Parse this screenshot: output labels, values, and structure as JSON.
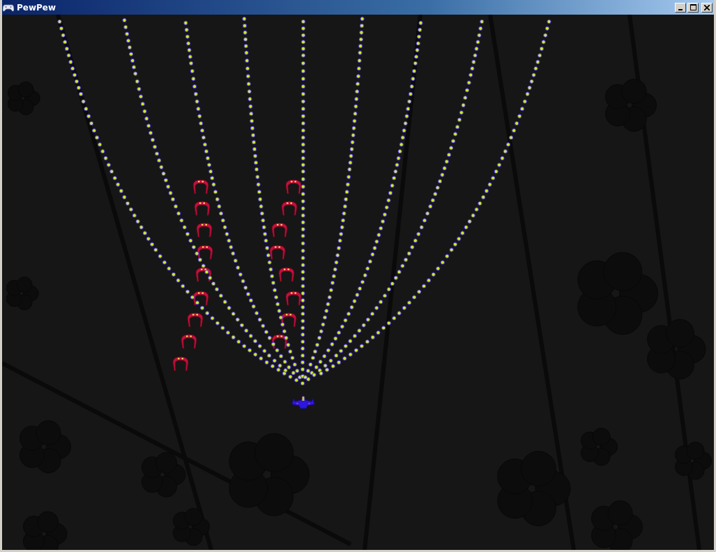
{
  "window": {
    "title": "PewPew"
  }
}
